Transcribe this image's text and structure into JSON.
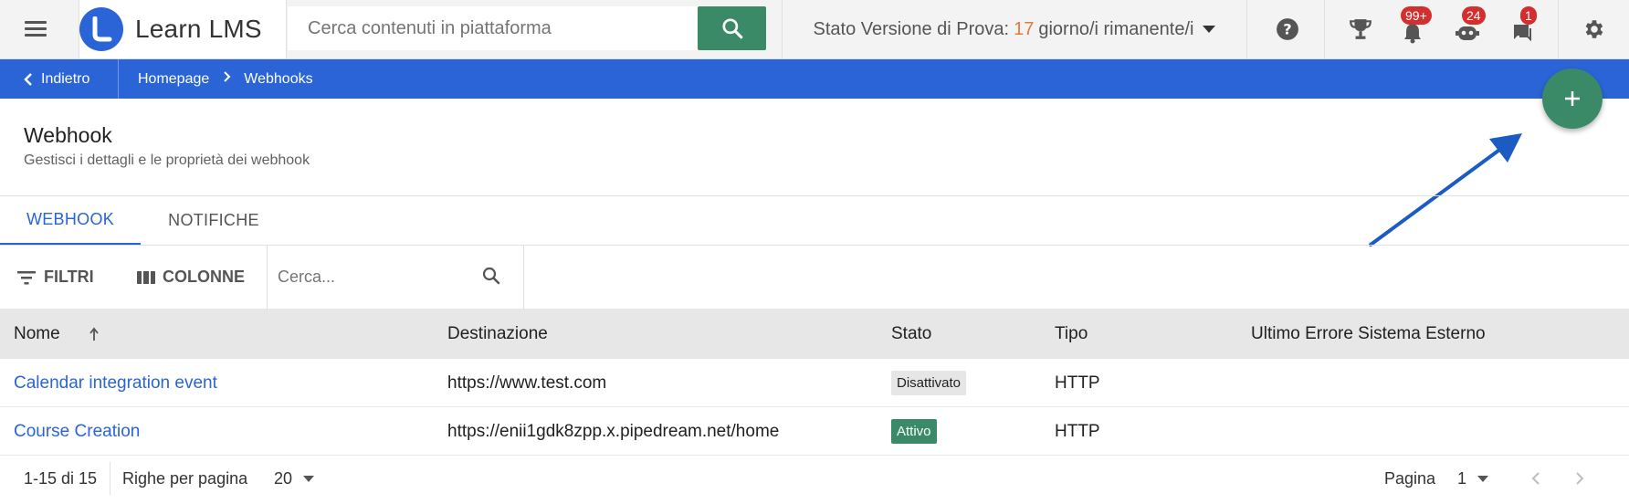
{
  "app": {
    "name": "Learn LMS"
  },
  "search": {
    "placeholder": "Cerca contenuti in piattaforma"
  },
  "trial": {
    "prefix": "Stato Versione di Prova:",
    "days": "17",
    "suffix": "giorno/i rimanente/i"
  },
  "badges": {
    "notifications": "99+",
    "messages_bot": "24",
    "chat": "1"
  },
  "breadcrumb": {
    "back_label": "Indietro",
    "items": [
      "Homepage",
      "Webhooks"
    ]
  },
  "page": {
    "title": "Webhook",
    "subtitle": "Gestisci i dettagli e le proprietà dei webhook"
  },
  "tabs": [
    {
      "label": "WEBHOOK",
      "active": true
    },
    {
      "label": "NOTIFICHE",
      "active": false
    }
  ],
  "toolbar": {
    "filters_label": "FILTRI",
    "columns_label": "COLONNE",
    "search_placeholder": "Cerca..."
  },
  "table": {
    "columns": [
      "Nome",
      "Destinazione",
      "Stato",
      "Tipo",
      "Ultimo Errore Sistema Esterno"
    ],
    "rows": [
      {
        "name": "Calendar integration event",
        "destination": "https://www.test.com",
        "status": "Disattivato",
        "type": "HTTP",
        "last_error": ""
      },
      {
        "name": "Course Creation",
        "destination": "https://enii1gdk8zpp.x.pipedream.net/home",
        "status": "Attivo",
        "type": "HTTP",
        "last_error": ""
      }
    ]
  },
  "pagination": {
    "range": "1-15 di 15",
    "rows_per_page_label": "Righe per pagina",
    "rows_per_page": "20",
    "page_label": "Pagina",
    "page": "1"
  },
  "icons": [
    "menu-icon",
    "search-icon",
    "help-icon",
    "trophy-icon",
    "bell-icon",
    "bot-icon",
    "chat-icon",
    "gear-icon",
    "chevron-left-icon",
    "chevron-right-icon",
    "plus-icon",
    "filter-icon",
    "columns-icon",
    "sort-up-icon"
  ],
  "colors": {
    "primary": "#2a64d6",
    "accent_green": "#3a8a67",
    "badge_red": "#d32f2f",
    "trial_days": "#e07b39"
  }
}
